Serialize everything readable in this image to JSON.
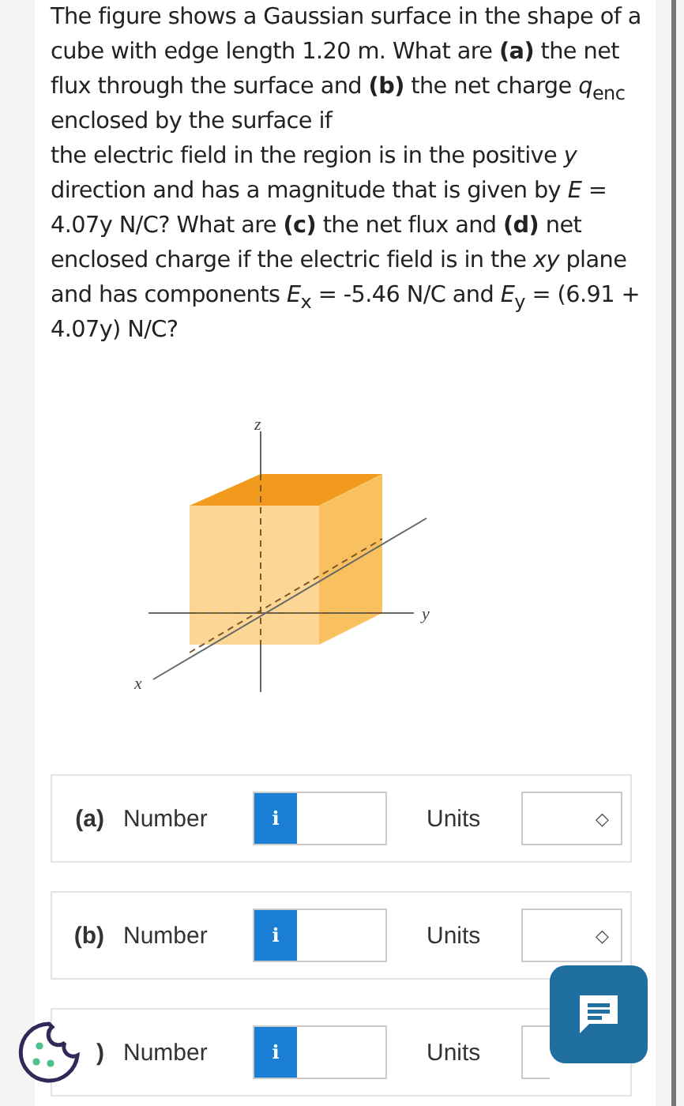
{
  "question": {
    "intro": "The figure shows a Gaussian surface in the shape of a cube with edge length 1.20 m. What are **(a)** the net flux through the surface and **(b)** the net charge *q*$_{enc}$ enclosed by the surface if",
    "body": "the electric field in the region is in the positive *y* direction and has a magnitude that is given by *E* = 4.07y N/C? What are **(c)** the net flux and **(d)** net enclosed charge if the electric field is in the *xy* plane and has components *E*$_{x}$ = -5.46 N/C and *E*$_{y}$ = (6.91 + 4.07y) N/C?"
  },
  "figure": {
    "axis_labels": {
      "z": "z",
      "y": "y",
      "x": "x"
    }
  },
  "answers": [
    {
      "label": "(a)",
      "field_label": "Number",
      "info": "i",
      "units_label": "Units",
      "chevron": "◇"
    },
    {
      "label": "(b)",
      "field_label": "Number",
      "info": "i",
      "units_label": "Units",
      "chevron": "◇"
    },
    {
      "label": ")",
      "field_label": "Number",
      "info": "i",
      "units_label": "Units"
    }
  ]
}
